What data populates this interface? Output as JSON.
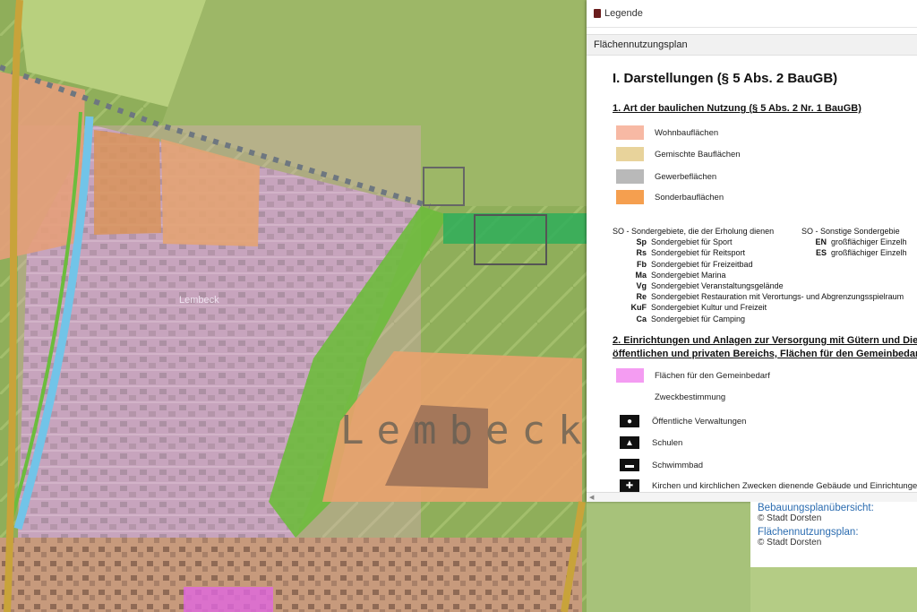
{
  "map": {
    "label_large": "Lembeck",
    "label_small": "Lembeck"
  },
  "legend": {
    "header_title": "Legende",
    "section_title": "Flächennutzungsplan",
    "heading_main": "I. Darstellungen (§ 5 Abs. 2 BauGB)",
    "heading_1": "1. Art der baulichen Nutzung (§ 5 Abs. 2 Nr. 1 BauGB)",
    "uses": [
      {
        "label": "Wohnbauflächen",
        "color": "#f7b9a4"
      },
      {
        "label": "Gemischte Bauflächen",
        "color": "#e8d39b"
      },
      {
        "label": "Gewerbeflächen",
        "color": "#b9b9b9"
      },
      {
        "label": "Sonderbauflächen",
        "color": "#f59f4f"
      }
    ],
    "so_left_title": "SO - Sondergebiete, die der Erholung dienen",
    "so_left": [
      {
        "code": "Sp",
        "text": "Sondergebiet für Sport"
      },
      {
        "code": "Rs",
        "text": "Sondergebiet für Reitsport"
      },
      {
        "code": "Fb",
        "text": "Sondergebiet für Freizeitbad"
      },
      {
        "code": "Ma",
        "text": "Sondergebiet Marina"
      },
      {
        "code": "Vg",
        "text": "Sondergebiet Veranstaltungsgelände"
      },
      {
        "code": "Re",
        "text": "Sondergebiet Restauration mit Verortungs- und Abgrenzungsspielraum"
      },
      {
        "code": "KuF",
        "text": "Sondergebiet Kultur und Freizeit"
      },
      {
        "code": "Ca",
        "text": "Sondergebiet für Camping"
      }
    ],
    "so_right_title": "SO - Sonstige Sondergebie",
    "so_right": [
      {
        "code": "EN",
        "text": "großflächiger Einzelh"
      },
      {
        "code": "ES",
        "text": "großflächiger Einzelh"
      }
    ],
    "heading_2_line1": "2. Einrichtungen und Anlagen zur Versorgung mit Gütern und Dien",
    "heading_2_line2": "öffentlichen und privaten Bereichs, Flächen für den Gemeinbedarf",
    "gemeinbedarf": {
      "label": "Flächen für den Gemeinbedarf",
      "color": "#f49cf2"
    },
    "zweck": "Zweckbestimmung",
    "symbols": [
      {
        "icon": "circle-in-square-icon",
        "glyph": "●",
        "label": "Öffentliche Verwaltungen"
      },
      {
        "icon": "triangle-icon",
        "glyph": "▲",
        "label": "Schulen"
      },
      {
        "icon": "wave-pool-icon",
        "glyph": "▬",
        "label": "Schwimmbad"
      },
      {
        "icon": "cross-icon",
        "glyph": "✚",
        "label": "Kirchen und kirchlichen Zwecken dienende Gebäude und Einrichtungen"
      }
    ]
  },
  "info": {
    "link1": "Bebauungsplanübersicht:",
    "copy1": "© Stadt Dorsten",
    "link2": "Flächennutzungsplan:",
    "copy2": "© Stadt Dorsten"
  }
}
